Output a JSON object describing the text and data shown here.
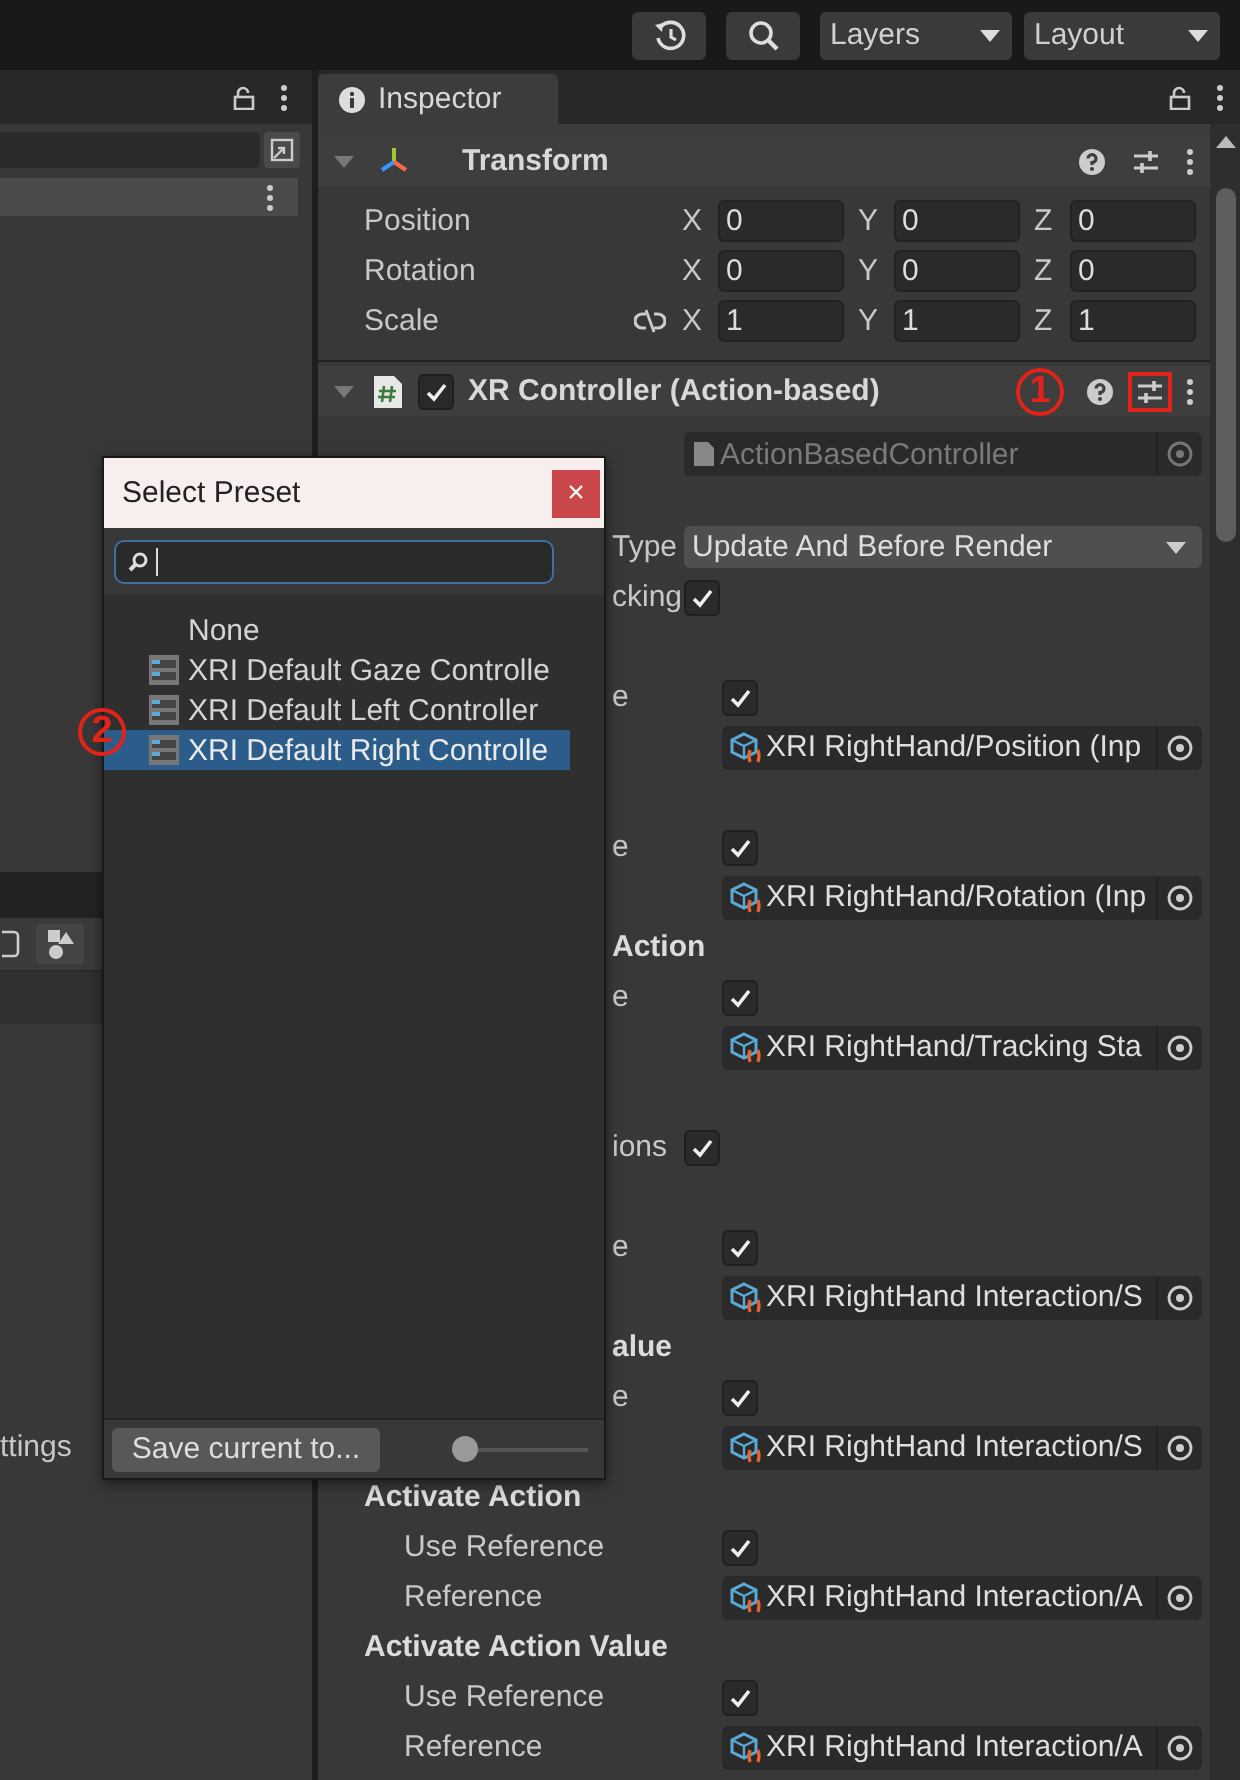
{
  "toolbar": {
    "dropdowns": [
      {
        "label": "Layers"
      },
      {
        "label": "Layout"
      }
    ]
  },
  "left_panel": {
    "partial_label": "ttings"
  },
  "inspector": {
    "tab": "Inspector",
    "transform": {
      "title": "Transform",
      "expanded": true,
      "rows": [
        {
          "label": "Position",
          "values": [
            {
              "axis": "X",
              "value": "0"
            },
            {
              "axis": "Y",
              "value": "0"
            },
            {
              "axis": "Z",
              "value": "0"
            }
          ]
        },
        {
          "label": "Rotation",
          "values": [
            {
              "axis": "X",
              "value": "0"
            },
            {
              "axis": "Y",
              "value": "0"
            },
            {
              "axis": "Z",
              "value": "0"
            }
          ]
        },
        {
          "label": "Scale",
          "proportions_locked": false,
          "values": [
            {
              "axis": "X",
              "value": "1"
            },
            {
              "axis": "Y",
              "value": "1"
            },
            {
              "axis": "Z",
              "value": "1"
            }
          ]
        }
      ]
    },
    "component": {
      "title": "XR Controller (Action-based)",
      "expanded": true,
      "enabled": true,
      "preset_highlighted": true,
      "script": "ActionBasedController",
      "sections": [
        {
          "rows": [
            {
              "kind": "dropdown",
              "label": "Type",
              "value": "Update And Before Render"
            },
            {
              "kind": "toggle",
              "label": "cking",
              "checked": true
            },
            {
              "kind": "group",
              "children": [
                {
                  "kind": "toggle",
                  "label": "e",
                  "checked": true
                },
                {
                  "kind": "reference",
                  "value": "XRI RightHand/Position (Inp"
                }
              ]
            },
            {
              "kind": "group",
              "children": [
                {
                  "kind": "toggle",
                  "label": "e",
                  "checked": true
                },
                {
                  "kind": "reference",
                  "value": "XRI RightHand/Rotation (Inp"
                }
              ]
            },
            {
              "kind": "group",
              "label": "Action",
              "children": [
                {
                  "kind": "toggle",
                  "label": "e",
                  "checked": true
                },
                {
                  "kind": "reference",
                  "value": "XRI RightHand/Tracking Sta"
                }
              ]
            }
          ]
        },
        {
          "rows": [
            {
              "kind": "toggle",
              "label": "ions",
              "checked": true
            },
            {
              "kind": "group",
              "children": [
                {
                  "kind": "toggle",
                  "label": "e",
                  "checked": true
                },
                {
                  "kind": "reference",
                  "value": "XRI RightHand Interaction/S"
                }
              ]
            },
            {
              "kind": "group",
              "label": "alue",
              "children": [
                {
                  "kind": "toggle",
                  "label": "e",
                  "checked": true
                },
                {
                  "kind": "reference",
                  "value": "XRI RightHand Interaction/S"
                }
              ]
            },
            {
              "kind": "group",
              "label": "Activate Action",
              "children": [
                {
                  "kind": "toggle",
                  "label": "Use Reference",
                  "checked": true
                },
                {
                  "kind": "reference",
                  "label": "Reference",
                  "value": "XRI RightHand Interaction/A"
                }
              ]
            },
            {
              "kind": "group",
              "label": "Activate Action Value",
              "children": [
                {
                  "kind": "toggle",
                  "label": "Use Reference",
                  "checked": true
                },
                {
                  "kind": "reference",
                  "label": "Reference",
                  "value": "XRI RightHand Interaction/A"
                }
              ]
            }
          ]
        }
      ]
    }
  },
  "preset_popup": {
    "title": "Select Preset",
    "close": "×",
    "items": [
      {
        "kind": "none",
        "label": "None",
        "selected": false
      },
      {
        "kind": "preset",
        "label": "XRI Default Gaze Controlle",
        "selected": false
      },
      {
        "kind": "preset",
        "label": "XRI Default Left Controller",
        "selected": false
      },
      {
        "kind": "preset",
        "label": "XRI Default Right Controlle",
        "selected": true
      }
    ],
    "save_button": "Save current to...",
    "size_slider": {
      "level": 0
    }
  },
  "annotations": [
    {
      "label": "1"
    },
    {
      "label": "2"
    }
  ]
}
